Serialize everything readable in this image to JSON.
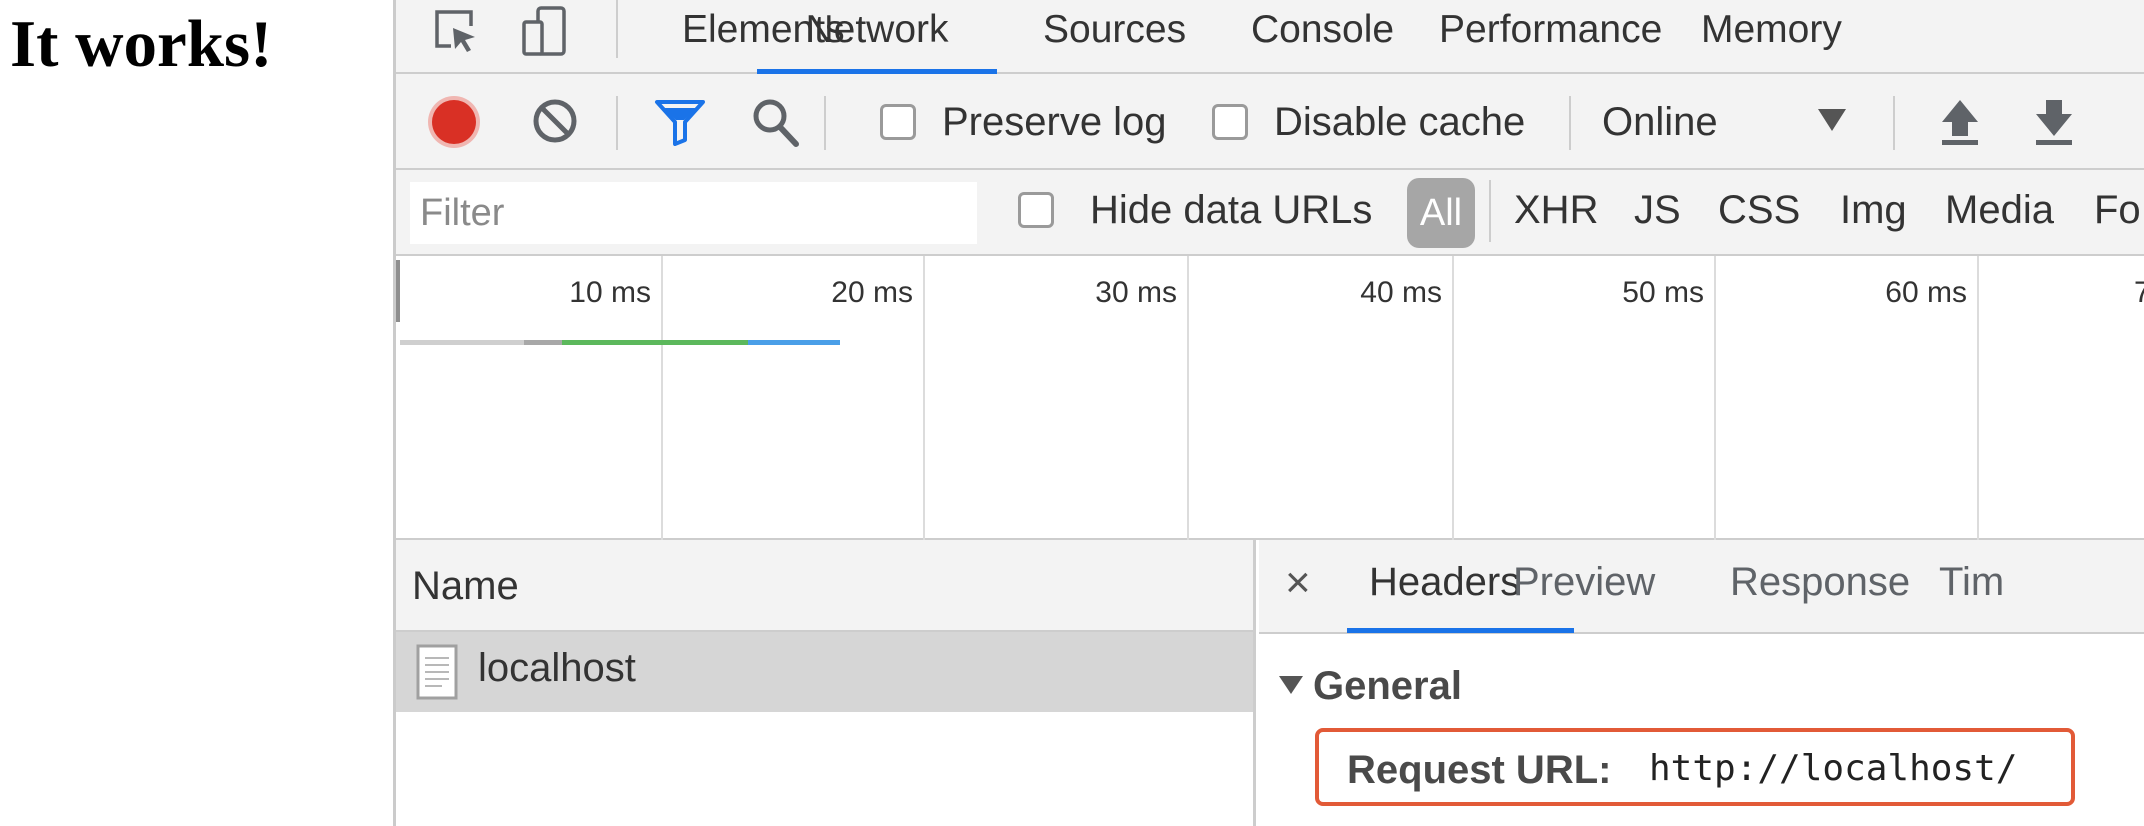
{
  "page": {
    "heading": "It works!"
  },
  "devtools": {
    "tabs": [
      "Elements",
      "Network",
      "Sources",
      "Console",
      "Performance",
      "Memory"
    ],
    "active_tab": "Network",
    "toolbar": {
      "preserve_log": "Preserve log",
      "disable_cache": "Disable cache",
      "throttling": "Online"
    },
    "filter": {
      "placeholder": "Filter",
      "hide_data_urls": "Hide data URLs",
      "all": "All",
      "types": [
        "XHR",
        "JS",
        "CSS",
        "Img",
        "Media",
        "Fo"
      ]
    },
    "timeline": {
      "labels": [
        "10 ms",
        "20 ms",
        "30 ms",
        "40 ms",
        "50 ms",
        "60 ms",
        "7"
      ]
    },
    "requests": {
      "column_name": "Name",
      "rows": [
        {
          "name": "localhost",
          "selected": true
        }
      ]
    },
    "details": {
      "close": "×",
      "tabs": [
        "Headers",
        "Preview",
        "Response",
        "Tim"
      ],
      "active_tab": "Headers",
      "section": "General",
      "request_url_label": "Request URL:",
      "request_url_value": "http://localhost/"
    },
    "colors": {
      "accent": "#1a73e8",
      "record": "#d93025",
      "highlight_box": "#e25a37",
      "timing_green": "#5cb85c",
      "timing_blue": "#4a9fe8"
    }
  }
}
